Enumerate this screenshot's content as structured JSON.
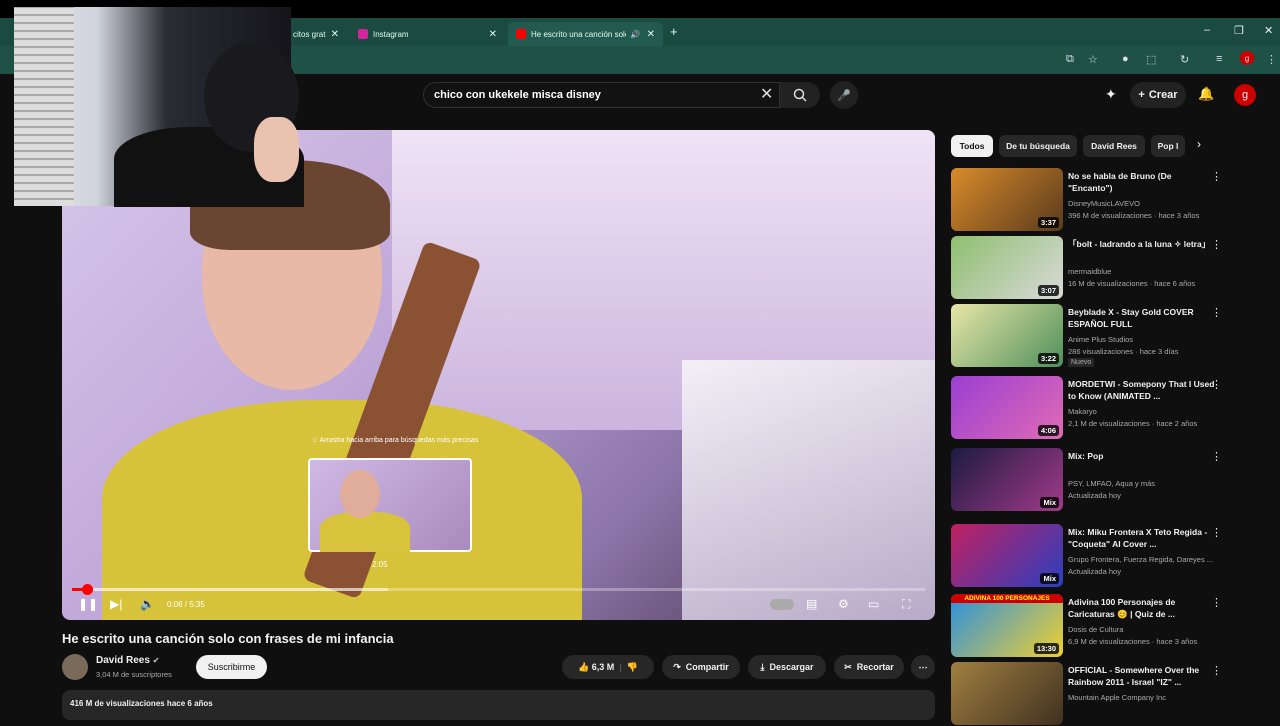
{
  "browser": {
    "tabs": [
      {
        "title": "citos grat",
        "favicon_color": "#4a7"
      },
      {
        "title": "Instagram",
        "favicon_color": "#d6249f"
      },
      {
        "title": "He escrito una canción solo",
        "favicon_color": "#f00"
      }
    ],
    "new_tab": "+",
    "window_controls": [
      "–",
      "❐",
      "✕"
    ],
    "profile_initial": "g"
  },
  "header": {
    "search_value": "chico con ukekele misca disney",
    "create_label": "Crear",
    "avatar_initial": "g"
  },
  "player": {
    "drag_hint": "☆ Arrastra hacia arriba para búsquedas más precisas",
    "preview_time": "2:05",
    "time": "0:06 / 5:35",
    "progress_played": 0.018,
    "progress_loaded": 0.37
  },
  "video": {
    "title": "He escrito una canción solo con frases de mi infancia",
    "channel": "David Rees",
    "subscribers": "3,04 M de suscriptores",
    "subscribe_label": "Suscribirme",
    "likes": "6,3 M",
    "share_label": "Compartir",
    "download_label": "Descargar",
    "clip_label": "Recortar",
    "more": "⋯",
    "description": "416 M de visualizaciones  hace 6 años"
  },
  "chips": [
    "Todos",
    "De tu búsqueda",
    "David Rees",
    "Pop l"
  ],
  "recommendations": [
    {
      "title": "No se habla de Bruno (De \"Encanto\")",
      "channel": "DisneyMusicLAVEVO",
      "meta": "396 M de visualizaciones · hace 3 años",
      "duration": "3:37",
      "colors": [
        "#d88b2a",
        "#5a3a1c"
      ]
    },
    {
      "title": "「bolt - ladrando a la luna ✧ letra」",
      "channel": "mermaidblue",
      "meta": "16 M de visualizaciones · hace 6 años",
      "duration": "3:07",
      "colors": [
        "#8fbf6f",
        "#d9d9d9"
      ]
    },
    {
      "title": "Beyblade X - Stay Gold COVER ESPAÑOL FULL",
      "channel": "Anime Plus Studios",
      "meta": "286 visualizaciones · hace 3 días",
      "badge": "Nuevo",
      "duration": "3:22",
      "colors": [
        "#e8e6a8",
        "#4f8f5a"
      ]
    },
    {
      "title": "MORDETWI - Somepony That I Used to Know (ANIMATED ...",
      "channel": "Makaryo",
      "meta": "2,1 M de visualizaciones · hace 2 años",
      "duration": "4:06",
      "colors": [
        "#9a3fd2",
        "#e06ab5"
      ]
    },
    {
      "title": "Mix: Pop",
      "channel": "PSY, LMFAO, Aqua y más",
      "meta": "Actualizada hoy",
      "duration": "Mix",
      "colors": [
        "#1b1b40",
        "#a23a8a"
      ]
    },
    {
      "title": "Mix: Miku Frontera X Teto Regida - \"Coqueta\" AI Cover ...",
      "channel": "Grupo Frontera, Fuerza Regida, Dareyes ...",
      "meta": "Actualizada hoy",
      "duration": "Mix",
      "colors": [
        "#c02060",
        "#2a40c0"
      ]
    },
    {
      "title": "Adivina 100 Personajes de Caricaturas 😊 | Quiz de ...",
      "channel": "Dosis de Cultura",
      "meta": "6,9 M de visualizaciones · hace 3 años",
      "duration": "13:30",
      "thumb_text": "ADIVINA 100 PERSONAJES",
      "colors": [
        "#2a8fe0",
        "#f0d030"
      ]
    },
    {
      "title": "OFFICIAL - Somewhere Over the Rainbow 2011 - Israel \"IZ\" ...",
      "channel": "Mountain Apple Company Inc",
      "meta": "",
      "duration": "",
      "colors": [
        "#a08040",
        "#403020"
      ]
    }
  ]
}
